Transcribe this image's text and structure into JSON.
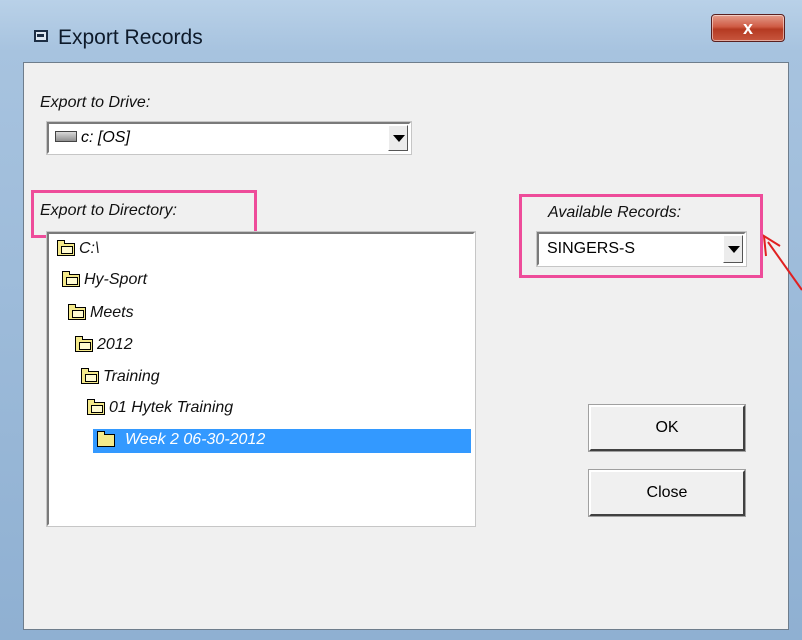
{
  "window": {
    "title": "Export Records",
    "close_label": "x"
  },
  "drive": {
    "label": "Export to Drive:",
    "value": "c: [OS]"
  },
  "directory": {
    "label": "Export to Directory:",
    "items": [
      {
        "label": "C:\\"
      },
      {
        "label": "Hy-Sport"
      },
      {
        "label": "Meets"
      },
      {
        "label": "2012"
      },
      {
        "label": "Training"
      },
      {
        "label": "01 Hytek Training"
      },
      {
        "label": "Week 2 06-30-2012",
        "selected": true
      }
    ]
  },
  "records": {
    "label": "Available Records:",
    "value": "SINGERS-S"
  },
  "buttons": {
    "ok": "OK",
    "close": "Close"
  },
  "colors": {
    "highlight": "#ee4c9a",
    "selection": "#3399ff",
    "arrow": "#e02020"
  }
}
